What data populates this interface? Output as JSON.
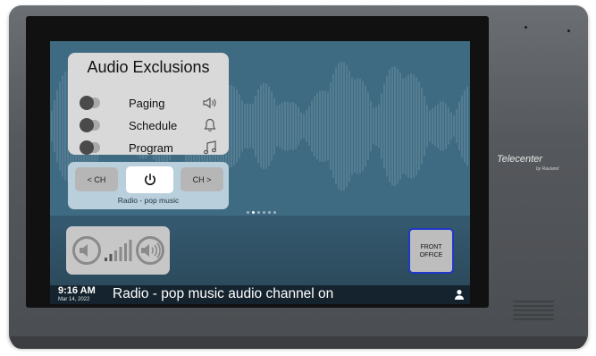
{
  "device": {
    "brand": "Telecenter",
    "brand_sub": "by Rauland"
  },
  "audio_exclusions": {
    "title": "Audio Exclusions",
    "items": [
      {
        "label": "Paging",
        "icon": "speaker-icon",
        "enabled": false
      },
      {
        "label": "Schedule",
        "icon": "bell-icon",
        "enabled": false
      },
      {
        "label": "Program",
        "icon": "music-note-icon",
        "enabled": false
      }
    ]
  },
  "channel": {
    "prev_label": "< CH",
    "next_label": "CH >",
    "power_icon": "power-icon",
    "current": "Radio - pop music"
  },
  "pager": {
    "pages": 6,
    "active": 1
  },
  "volume": {
    "down_icon": "speaker-muted-icon",
    "up_icon": "speaker-loud-icon",
    "level_bars": 6
  },
  "location_button": {
    "line1": "FRONT",
    "line2": "OFFICE",
    "border_color": "#2038c8"
  },
  "status_bar": {
    "time": "9:16 AM",
    "date": "Mar 14, 2022",
    "message": "Radio - pop music audio channel on",
    "user_icon": "user-icon"
  },
  "colors": {
    "wallpaper": "#3f6b82",
    "status_bar": "#14232e",
    "panel": "#d9d9d9"
  }
}
